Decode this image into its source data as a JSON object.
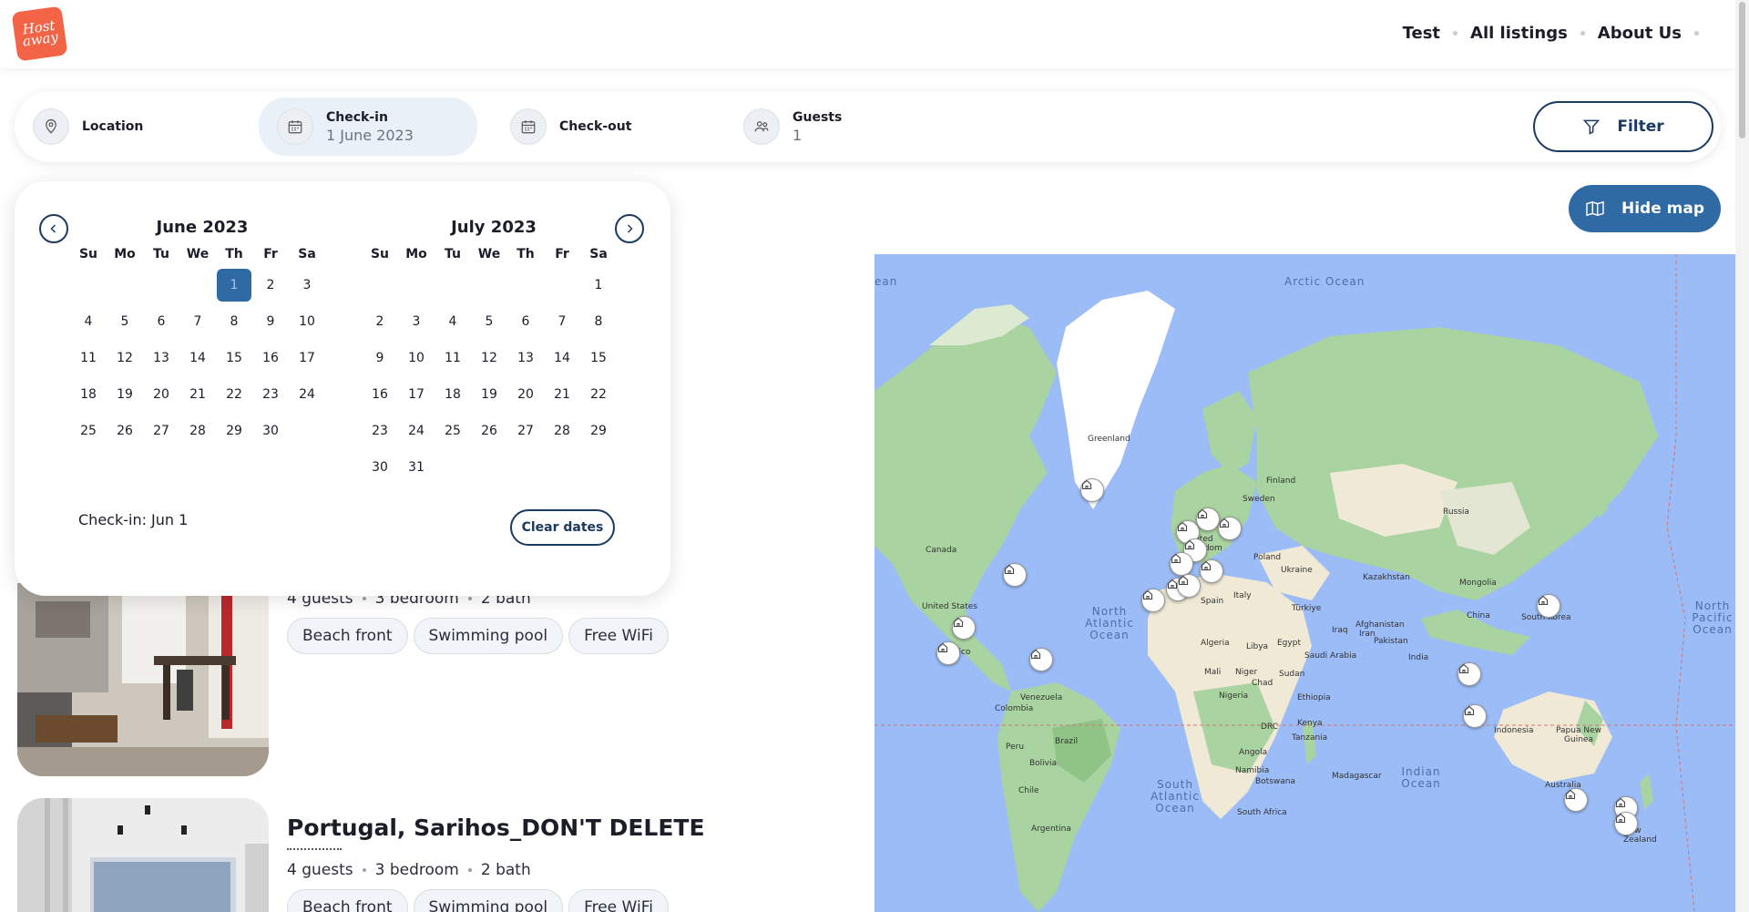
{
  "brand": {
    "logo_text": "Host away",
    "color": "#f26445"
  },
  "nav": {
    "items": [
      "Test",
      "All listings",
      "About Us"
    ]
  },
  "search": {
    "location_label": "Location",
    "checkin_label": "Check-in",
    "checkin_value": "1 June 2023",
    "checkout_label": "Check-out",
    "guests_label": "Guests",
    "guests_value": "1",
    "filter_label": "Filter"
  },
  "hide_map_label": "Hide map",
  "calendar": {
    "months": [
      {
        "title": "June 2023",
        "offset": 4,
        "days": 30,
        "selected": 1
      },
      {
        "title": "July 2023",
        "offset": 6,
        "days": 31,
        "selected": null
      }
    ],
    "weekdays": [
      "Su",
      "Mo",
      "Tu",
      "We",
      "Th",
      "Fr",
      "Sa"
    ],
    "status": "Check-in: Jun 1",
    "clear_label": "Clear dates"
  },
  "listings": [
    {
      "guests": "4 guests",
      "bedrooms": "3 bedroom",
      "baths": "2 bath",
      "tags": [
        "Beach front",
        "Swimming pool",
        "Free WiFi"
      ]
    },
    {
      "title": "Portugal, Sarihos_DON'T DELETE",
      "guests": "4 guests",
      "bedrooms": "3 bedroom",
      "baths": "2 bath",
      "tags": [
        "Beach front",
        "Swimming pool",
        "Free WiFi"
      ]
    }
  ],
  "map": {
    "oceans": [
      "Arctic Ocean",
      "North Atlantic Ocean",
      "South Atlantic Ocean",
      "Indian Ocean",
      "North Pacific Ocean",
      "ean"
    ],
    "labels": [
      "Greenland",
      "Canada",
      "United States",
      "Mexico",
      "Venezuela",
      "Colombia",
      "Peru",
      "Brazil",
      "Bolivia",
      "Chile",
      "Argentina",
      "Finland",
      "Sweden",
      "United Kingdom",
      "Poland",
      "Ukraine",
      "Spain",
      "Italy",
      "Türkiye",
      "Russia",
      "Kazakhstan",
      "Mongolia",
      "China",
      "South Korea",
      "Afghanistan",
      "Iraq",
      "Iran",
      "Pakistan",
      "India",
      "Saudi Arabia",
      "Egypt",
      "Libya",
      "Algeria",
      "Mali",
      "Niger",
      "Chad",
      "Sudan",
      "Nigeria",
      "Ethiopia",
      "Kenya",
      "DRC",
      "Tanzania",
      "Angola",
      "Namibia",
      "Botswana",
      "South Africa",
      "Madagascar",
      "Indonesia",
      "Papua New Guinea",
      "Australia",
      "New Zealand"
    ]
  }
}
